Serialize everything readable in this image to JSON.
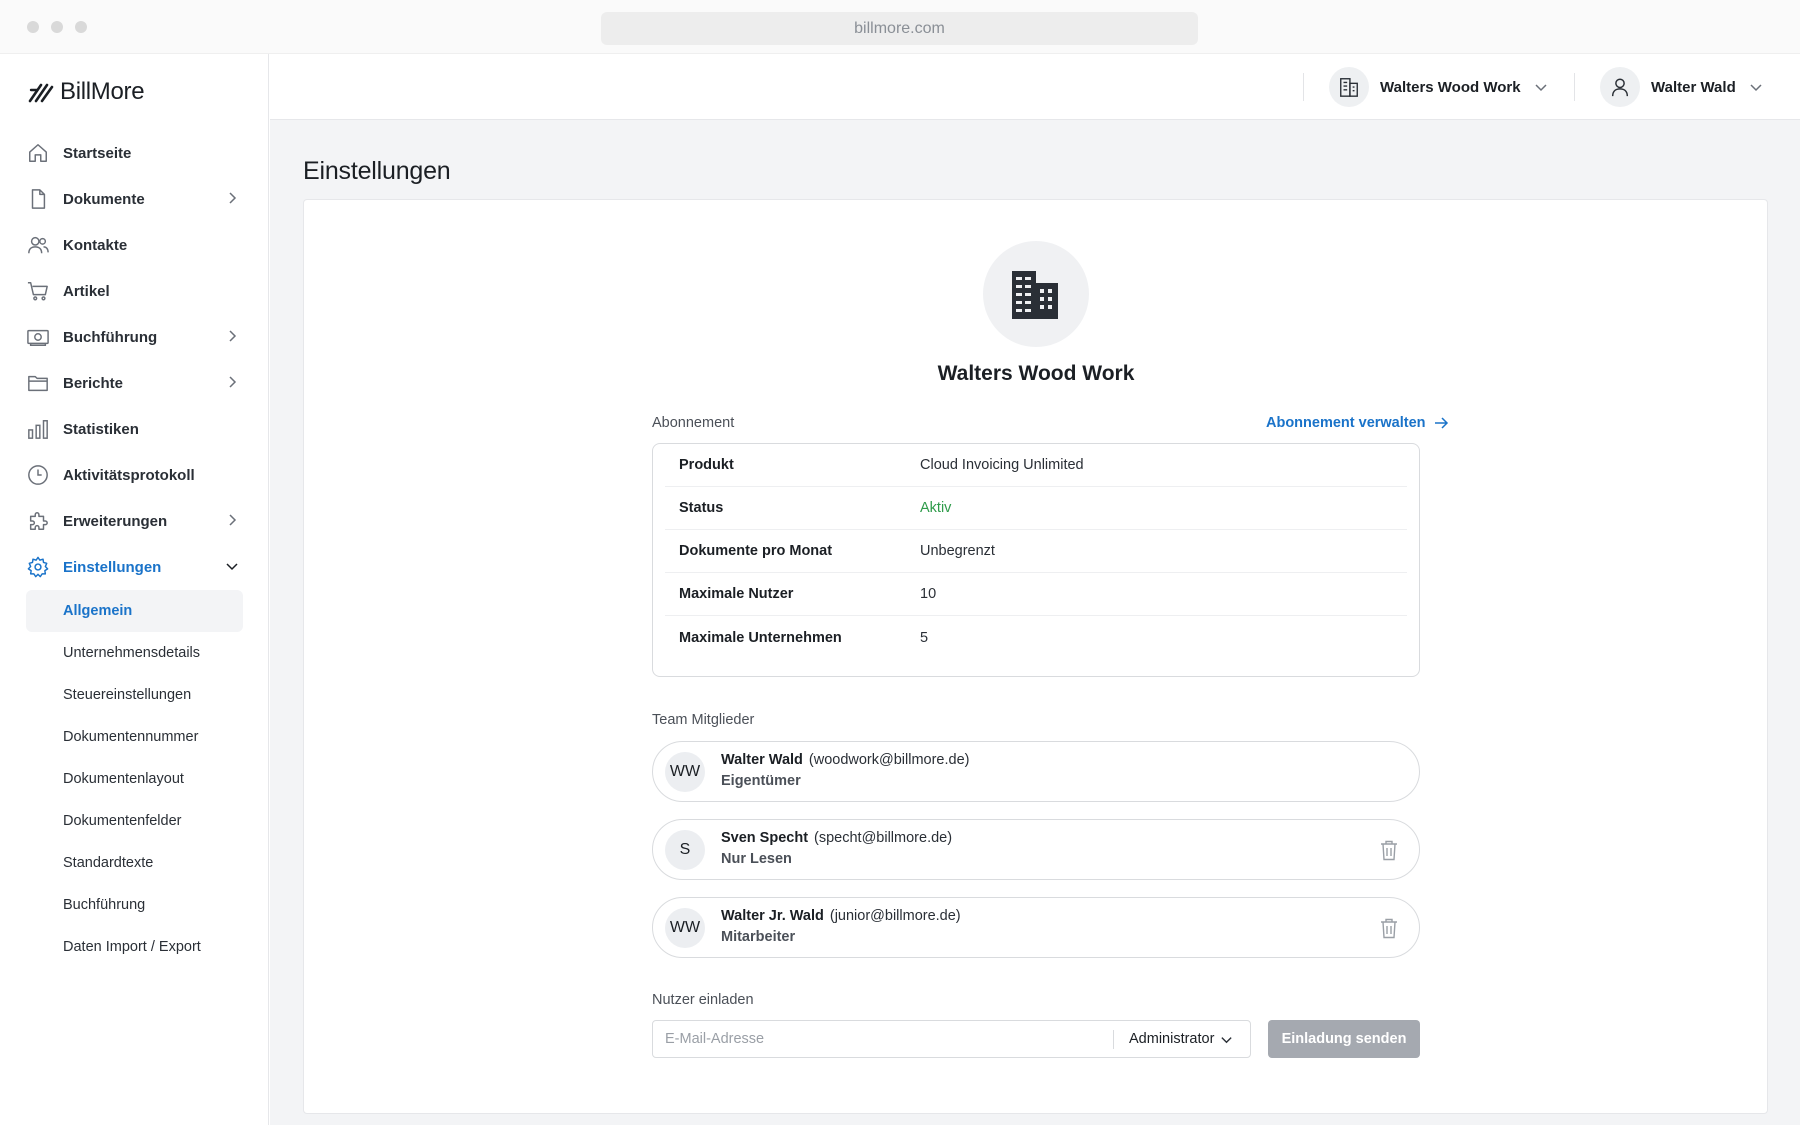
{
  "browser": {
    "url": "billmore.com"
  },
  "app": {
    "logo_text": "BillMore"
  },
  "sidebar": {
    "items": [
      {
        "label": "Startseite",
        "icon": "home-icon"
      },
      {
        "label": "Dokumente",
        "icon": "document-icon",
        "expandable": true
      },
      {
        "label": "Kontakte",
        "icon": "contacts-icon"
      },
      {
        "label": "Artikel",
        "icon": "cart-icon"
      },
      {
        "label": "Buchführung",
        "icon": "money-icon",
        "expandable": true
      },
      {
        "label": "Berichte",
        "icon": "folder-icon",
        "expandable": true
      },
      {
        "label": "Statistiken",
        "icon": "bar-chart-icon"
      },
      {
        "label": "Aktivitätsprotokoll",
        "icon": "clock-icon"
      },
      {
        "label": "Erweiterungen",
        "icon": "puzzle-icon",
        "expandable": true
      },
      {
        "label": "Einstellungen",
        "icon": "gear-icon",
        "expanded": true,
        "active": true
      }
    ],
    "settings_sub": [
      "Allgemein",
      "Unternehmensdetails",
      "Steuereinstellungen",
      "Dokumentennummer",
      "Dokumentenlayout",
      "Dokumentenfelder",
      "Standardtexte",
      "Buchführung",
      "Daten Import / Export"
    ],
    "active_sub": "Allgemein"
  },
  "header": {
    "company": "Walters Wood Work",
    "user": "Walter Wald"
  },
  "main": {
    "title": "Einstellungen",
    "company_name": "Walters Wood Work",
    "subscription": {
      "label": "Abonnement",
      "manage_link": "Abonnement verwalten",
      "rows": [
        {
          "key": "Produkt",
          "value": "Cloud Invoicing Unlimited"
        },
        {
          "key": "Status",
          "value": "Aktiv"
        },
        {
          "key": "Dokumente pro Monat",
          "value": "Unbegrenzt"
        },
        {
          "key": "Maximale Nutzer",
          "value": "10"
        },
        {
          "key": "Maximale Unternehmen",
          "value": "5"
        }
      ]
    },
    "team": {
      "label": "Team Mitglieder",
      "members": [
        {
          "initials": "WW",
          "name": "Walter Wald",
          "email": "(woodwork@billmore.de)",
          "role": "Eigentümer",
          "removable": false
        },
        {
          "initials": "S",
          "name": "Sven Specht",
          "email": "(specht@billmore.de)",
          "role": "Nur Lesen",
          "removable": true
        },
        {
          "initials": "WW",
          "name": "Walter Jr. Wald",
          "email": "(junior@billmore.de)",
          "role": "Mitarbeiter",
          "removable": true
        }
      ]
    },
    "invite": {
      "label": "Nutzer einladen",
      "email_placeholder": "E-Mail-Adresse",
      "email_value": "",
      "role": "Administrator",
      "send_label": "Einladung senden"
    }
  },
  "colors": {
    "accent": "#1a73c9",
    "status_active": "#2e9b4a",
    "disabled_button": "#a5a9b0",
    "background": "#f3f4f6"
  }
}
